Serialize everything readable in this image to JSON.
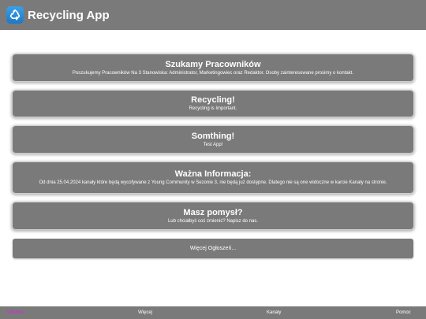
{
  "header": {
    "title": "Recycling App",
    "icon": "recycle-icon"
  },
  "announcements": [
    {
      "title": "Szukamy Pracowników",
      "text": "Poszukujemy Pracowników Na 3 Stanowiska: Administrator, Marketingowiec oraz Redaktor. Osoby zainteresowane prosimy o kontakt."
    },
    {
      "title": "Recycling!",
      "text": "Recycling is Important."
    },
    {
      "title": "Somthing!",
      "text": "Test App!"
    },
    {
      "title": "Ważna Informacja:",
      "text": "Od dnia 25.04.2024 kanały które będą wycofywane z Young Community w Sezonie 3, nie będą już dostępne. Dlatego nie są one widoczne w karcie Kanały na stronie."
    },
    {
      "title": "Masz pomysł?",
      "text": "Lub chciałbyś coś zmienić? Napisz do nas."
    }
  ],
  "more_button": {
    "label": "Więcej Ogłoszeń..."
  },
  "nav": {
    "home": "Główna",
    "more": "Więcej",
    "channels": "Kanały",
    "help": "Pomoc"
  },
  "colors": {
    "bar": "#7a7a7a",
    "active_nav": "#e020e0",
    "icon_blue": "#1f78c8"
  }
}
